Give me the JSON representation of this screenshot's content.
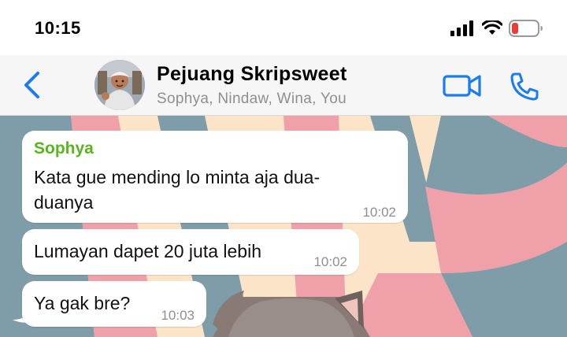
{
  "status_bar": {
    "time": "10:15",
    "icons": [
      "signal-icon",
      "wifi-icon",
      "battery-low-icon"
    ]
  },
  "header": {
    "back_icon": "chevron-left-icon",
    "group_name": "Pejuang Skripsweet",
    "members": "Sophya, Nindaw, Wina, You",
    "video_icon": "video-camera-icon",
    "call_icon": "phone-icon",
    "accent_color": "#1a7cf2"
  },
  "messages": [
    {
      "sender": "Sophya",
      "text": "Kata gue mending lo minta aja dua-duanya",
      "time": "10:02"
    },
    {
      "text": "Lumayan dapet 20 juta lebih",
      "time": "10:02"
    },
    {
      "text": "Ya gak bre?",
      "time": "10:03"
    }
  ],
  "colors": {
    "sender_name": "#58b51f",
    "wallpaper_pink": "#f0a0a8",
    "wallpaper_slate": "#7f9da8",
    "wallpaper_cream": "#fbe4c8"
  }
}
